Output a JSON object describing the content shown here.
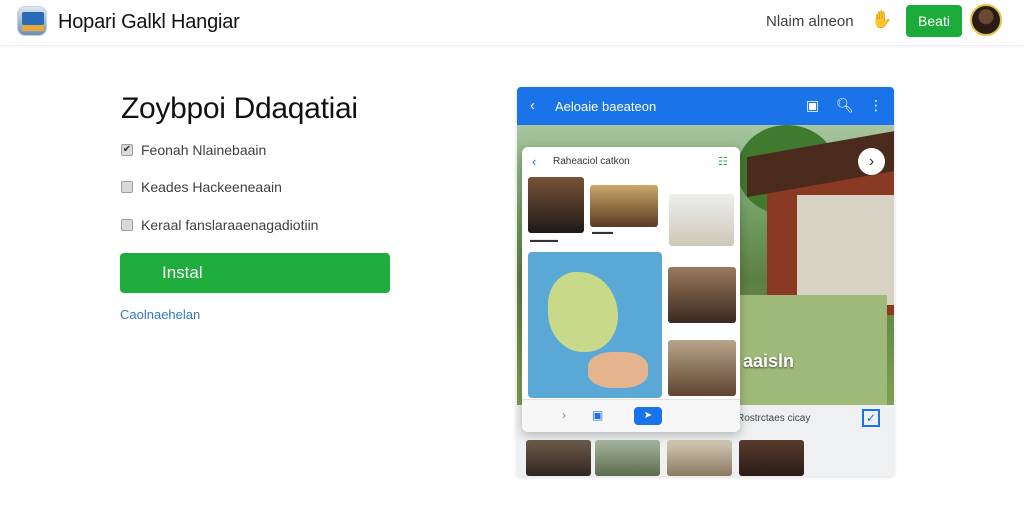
{
  "header": {
    "app_title": "Hopari Galkl Hangiar",
    "user_name": "Nlaim alneon",
    "action_button": "Beati"
  },
  "main": {
    "headline": "Zoybpoi Ddaqatiai",
    "features": [
      {
        "label": "Feonah Nlainebaain",
        "checked": true
      },
      {
        "label": "Keades Hackeeneaain",
        "checked": false
      },
      {
        "label": "Keraal fanslaraaenagadiotiin",
        "checked": false
      }
    ],
    "install_label": "Instal",
    "cancel_label": "Caolnaehelan"
  },
  "preview": {
    "bar_title": "Aeloaie baeateon",
    "photo_caption": "aaisln",
    "strip_label": "Rostrctaes cicay",
    "card": {
      "title": "Raheaciol catkon"
    }
  },
  "colors": {
    "accent_green": "#1fae3e",
    "accent_blue": "#1a73e8",
    "link_blue": "#2f7bc0"
  },
  "icons": {
    "hand": "wave-icon",
    "back": "back-arrow-icon",
    "search": "search-icon",
    "more": "more-vert-icon"
  }
}
